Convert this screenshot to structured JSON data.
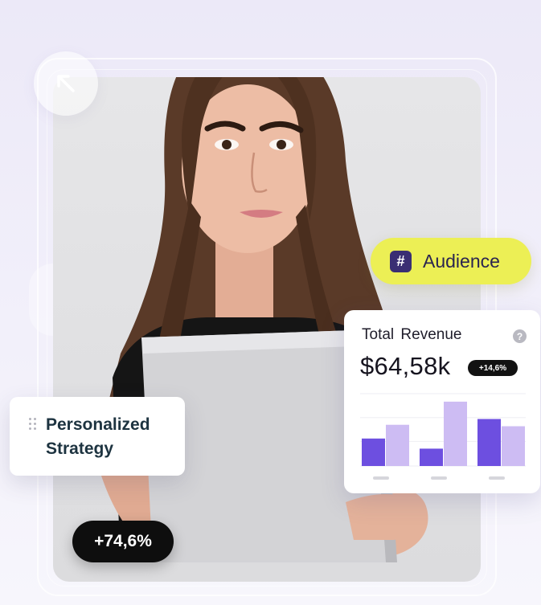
{
  "audience_tag": {
    "icon": "hashtag-icon",
    "icon_glyph": "#",
    "label": "Audience",
    "color": "#ecef55"
  },
  "revenue_card": {
    "title": "Total Revenue",
    "help_icon": "question-circle-icon",
    "help_glyph": "?",
    "amount": "$64,58k",
    "change_badge": "+14,6%"
  },
  "chart_data": {
    "type": "bar",
    "categories": [
      "",
      "",
      ""
    ],
    "series": [
      {
        "values": [
          38,
          24,
          65
        ],
        "color": "#6d4fe0"
      },
      {
        "values": [
          57,
          89,
          55
        ],
        "color": "#cdbcf3"
      }
    ],
    "ylim": [
      0,
      100
    ],
    "grid": true,
    "legend": "none"
  },
  "strategy_card": {
    "handle_icon": "drag-handle-icon",
    "label": "Personalized Strategy"
  },
  "growth_badge": {
    "value": "+74,6%"
  },
  "corner_button": {
    "icon": "arrow-up-left-icon"
  },
  "colors": {
    "accent_purple": "#6d4fe0",
    "accent_lavender": "#cdbcf3",
    "dark": "#0e0e0e",
    "background": "#ece9f8"
  }
}
